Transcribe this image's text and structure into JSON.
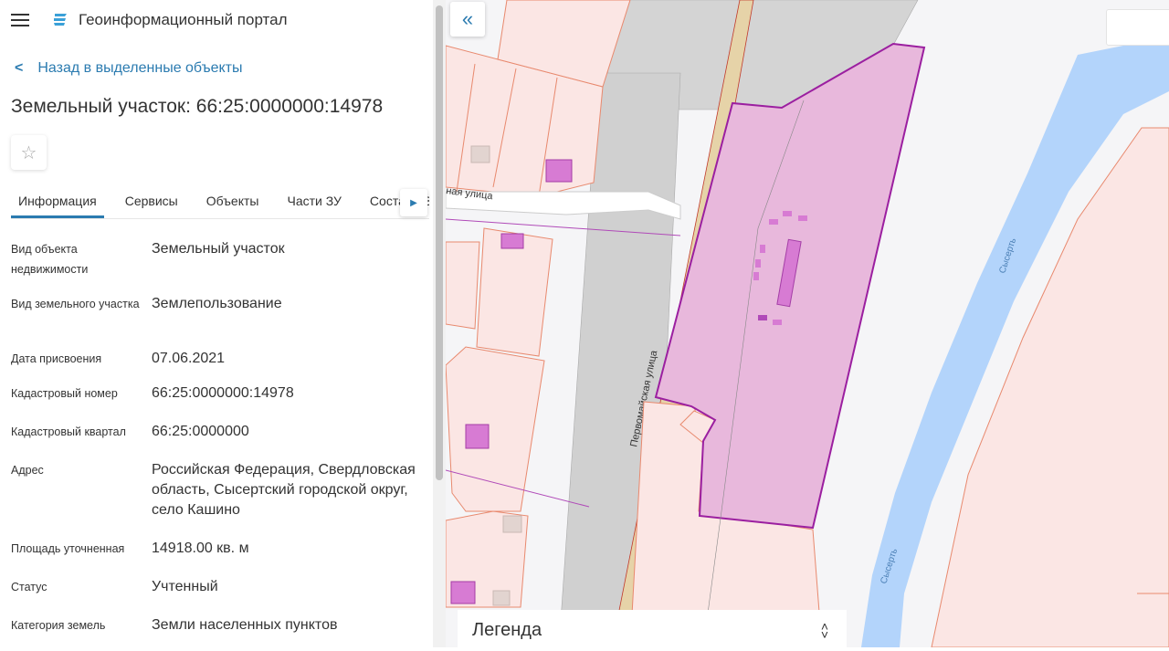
{
  "header": {
    "app_title": "Геоинформационный портал",
    "menu_icon": "hamburger-icon",
    "logo_icon": "portal-logo"
  },
  "back_link": "Назад в выделенные объекты",
  "object_title": "Земельный участок: 66:25:0000000:14978",
  "tabs": [
    {
      "label": "Информация",
      "active": true
    },
    {
      "label": "Сервисы"
    },
    {
      "label": "Объекты"
    },
    {
      "label": "Части ЗУ"
    },
    {
      "label": "Состав ЕЗ"
    }
  ],
  "info": [
    {
      "label": "Вид объекта недвижимости",
      "value": "Земельный участок"
    },
    {
      "label": "Вид земельного участка",
      "value": "Землепользование"
    },
    {
      "label": "Дата присвоения",
      "value": "07.06.2021"
    },
    {
      "label": "Кадастровый номер",
      "value": "66:25:0000000:14978"
    },
    {
      "label": "Кадастровый квартал",
      "value": "66:25:0000000"
    },
    {
      "label": "Адрес",
      "value": "Российская Федерация, Свердловская область, Сысертский городской округ, село Кашино"
    },
    {
      "label": "Площадь уточненная",
      "value": "14918.00 кв. м"
    },
    {
      "label": "Статус",
      "value": "Учтенный"
    },
    {
      "label": "Категория земель",
      "value": "Земли населенных пунктов"
    }
  ],
  "map": {
    "street_1": "Первомайская улица",
    "street_2": "ная улица",
    "river": "Сысерть",
    "colors": {
      "parcel": "#e8b8dc",
      "parcel_border": "#9b1fa0",
      "lots": "#fbe6e4",
      "lot_border": "#e8896e",
      "river": "#b3d4fb",
      "road": "#d0d0d0"
    }
  },
  "legend": {
    "label": "Легенда"
  }
}
